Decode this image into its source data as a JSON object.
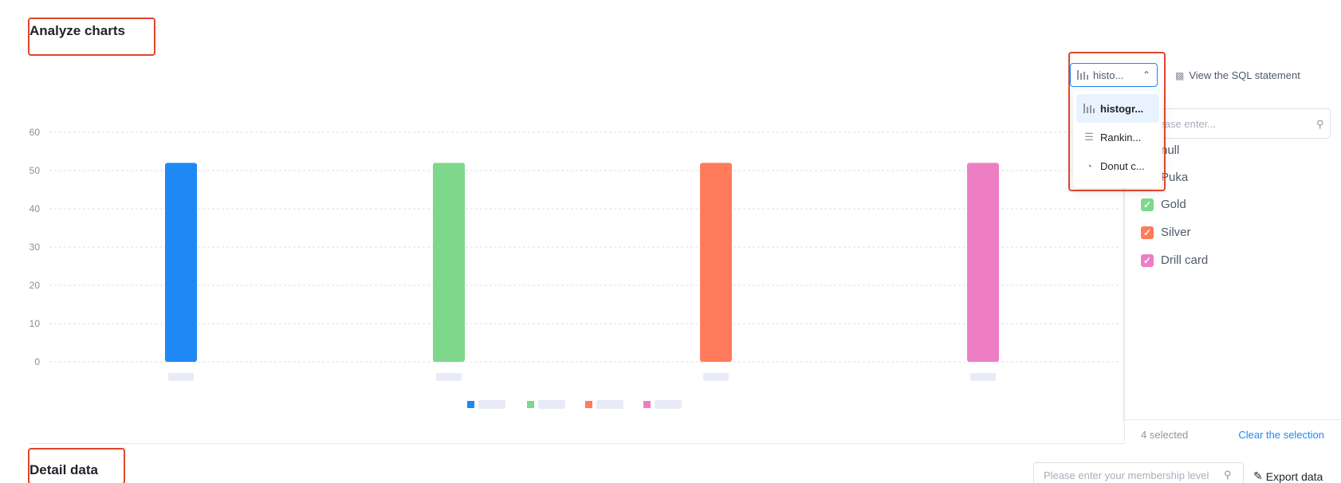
{
  "sections": {
    "analyze_title": "Analyze charts",
    "detail_title": "Detail data"
  },
  "chart_type_select": {
    "value": "histo...",
    "open": true,
    "options": [
      {
        "label": "histogr...",
        "icon": "bar-chart-icon",
        "selected": true
      },
      {
        "label": "Rankin...",
        "icon": "ranking-chart-icon",
        "selected": false
      },
      {
        "label": "Donut c...",
        "icon": "donut-chart-icon",
        "selected": false
      }
    ]
  },
  "view_sql": "View the SQL statement",
  "filter": {
    "search_placeholder": "Please enter...",
    "items": [
      {
        "label": "null",
        "checked": false,
        "color": "#1e88f5"
      },
      {
        "label": "Puka",
        "checked": true,
        "color": "#1e88f5"
      },
      {
        "label": "Gold",
        "checked": true,
        "color": "#7dd88b"
      },
      {
        "label": "Silver",
        "checked": true,
        "color": "#ff7b5c"
      },
      {
        "label": "Drill card",
        "checked": true,
        "color": "#ee7ec4"
      }
    ],
    "selected_count": "4 selected",
    "clear_label": "Clear the selection"
  },
  "detail": {
    "search_placeholder": "Please enter your membership level",
    "export_label": "Export data"
  },
  "chart_data": {
    "type": "bar",
    "title": "",
    "xlabel": "",
    "ylabel": "",
    "ylim": [
      0,
      60
    ],
    "yticks": [
      0,
      10,
      20,
      30,
      40,
      50,
      60
    ],
    "grid": true,
    "legend": "bottom-center",
    "categories": [
      "",
      "",
      "",
      ""
    ],
    "values": [
      52,
      52,
      52,
      52
    ],
    "colors": [
      "#1e88f5",
      "#7dd88b",
      "#ff7b5c",
      "#ee7ec4"
    ]
  }
}
